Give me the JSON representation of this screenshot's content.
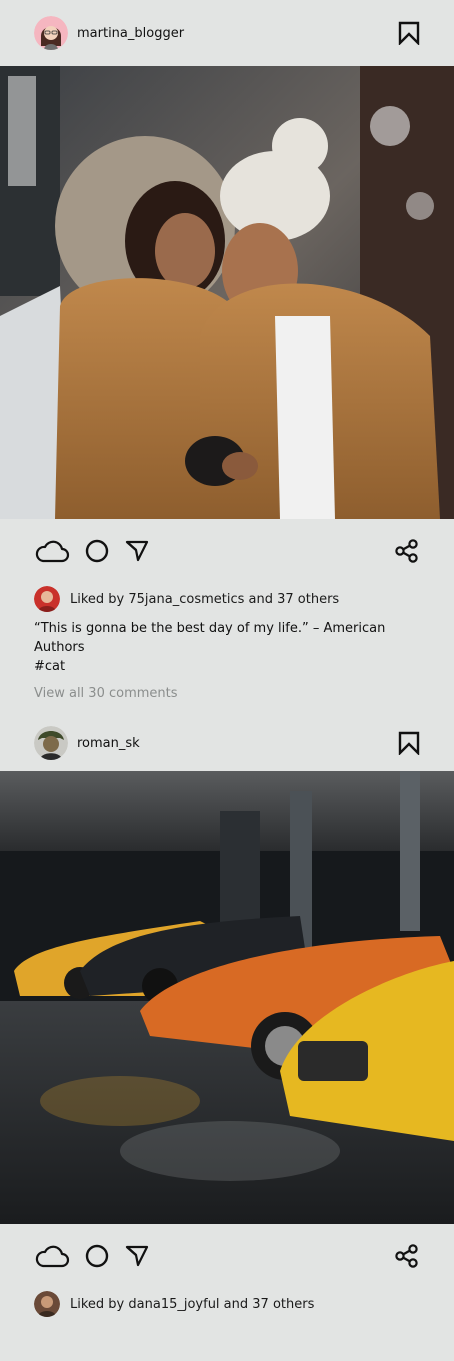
{
  "posts": [
    {
      "username": "martina_blogger",
      "liked_by_prefix": "Liked by ",
      "liked_by_user": "75jana_cosmetics",
      "liked_by_suffix": " and 37 others",
      "caption": "“This is gonna be the best day of my life.” – American Authors",
      "hashtag": "#cat",
      "view_comments": "View all 30 comments"
    },
    {
      "username": "roman_sk",
      "liked_by_prefix": "Liked by ",
      "liked_by_user": "dana15_joyful",
      "liked_by_suffix": " and 37 others"
    }
  ],
  "icons": {
    "like": "cloud-icon",
    "comment": "circle-icon",
    "send": "send-icon",
    "share": "share-icon",
    "save": "bookmark-icon"
  },
  "colors": {
    "background": "#e2e4e3",
    "text": "#111111",
    "muted": "#8b8e8d"
  }
}
